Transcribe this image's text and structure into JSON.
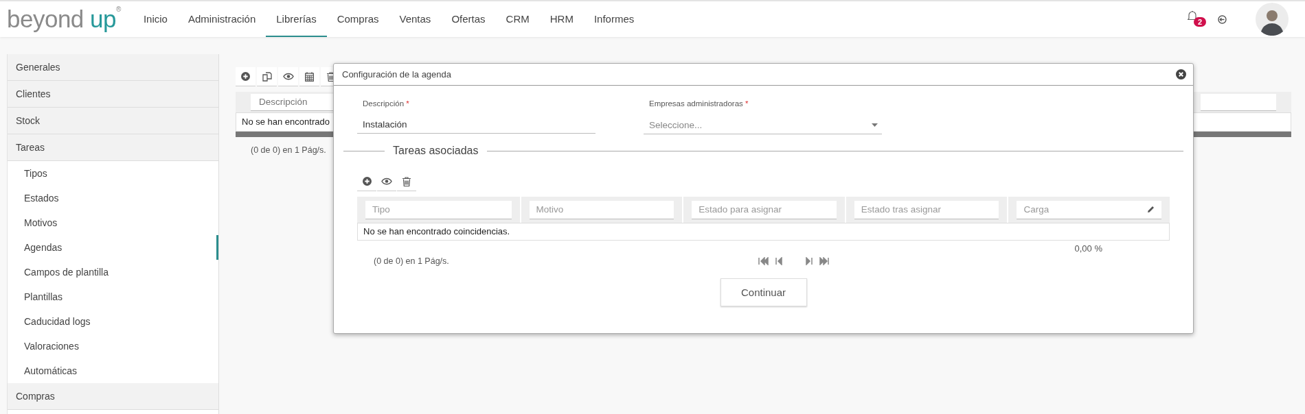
{
  "header": {
    "logo": {
      "main": "beyond",
      "accent": "up",
      "mark": "®"
    },
    "nav": [
      {
        "label": "Inicio",
        "selected": false
      },
      {
        "label": "Administración",
        "selected": false
      },
      {
        "label": "Librerías",
        "selected": true
      },
      {
        "label": "Compras",
        "selected": false
      },
      {
        "label": "Ventas",
        "selected": false
      },
      {
        "label": "Ofertas",
        "selected": false
      },
      {
        "label": "CRM",
        "selected": false
      },
      {
        "label": "HRM",
        "selected": false
      },
      {
        "label": "Informes",
        "selected": false
      }
    ],
    "notifications": {
      "count": "2"
    }
  },
  "sidebar": {
    "items": [
      {
        "label": "Generales"
      },
      {
        "label": "Clientes"
      },
      {
        "label": "Stock"
      },
      {
        "label": "Tareas",
        "children": [
          {
            "label": "Tipos",
            "selected": false
          },
          {
            "label": "Estados",
            "selected": false
          },
          {
            "label": "Motivos",
            "selected": false
          },
          {
            "label": "Agendas",
            "selected": true
          },
          {
            "label": "Campos de plantilla",
            "selected": false
          },
          {
            "label": "Plantillas",
            "selected": false
          },
          {
            "label": "Caducidad logs",
            "selected": false
          },
          {
            "label": "Valoraciones",
            "selected": false
          },
          {
            "label": "Automáticas",
            "selected": false
          }
        ]
      },
      {
        "label": "Compras"
      }
    ]
  },
  "main": {
    "toolbar": [
      {
        "kind": "add"
      },
      {
        "kind": "copy"
      },
      {
        "kind": "view"
      },
      {
        "kind": "calendar"
      },
      {
        "kind": "delete"
      }
    ],
    "table": {
      "filters": [
        {
          "placeholder": "Descripción"
        }
      ],
      "empty_message": "No se han encontrado"
    },
    "pager": "(0 de 0) en 1 Pág/s."
  },
  "dialog": {
    "title": "Configuración de la agenda",
    "fields": [
      {
        "kind": "text",
        "label": "Descripción",
        "required_mark": "*",
        "value": "Instalación"
      },
      {
        "kind": "select",
        "label": "Empresas administradoras",
        "required_mark": "*",
        "placeholder": "Seleccione..."
      }
    ],
    "section": "Tareas asociadas",
    "toolbar": [
      {
        "kind": "add"
      },
      {
        "kind": "view"
      },
      {
        "kind": "delete"
      }
    ],
    "table": {
      "filters": [
        {
          "placeholder": "Tipo",
          "editable": false
        },
        {
          "placeholder": "Motivo",
          "editable": false
        },
        {
          "placeholder": "Estado para asignar",
          "editable": false
        },
        {
          "placeholder": "Estado tras asignar",
          "editable": false
        },
        {
          "placeholder": "Carga",
          "editable": true
        }
      ],
      "empty_message": "No se han encontrado coincidencias.",
      "total": "0,00 %"
    },
    "pager": "(0 de 0) en 1 Pág/s.",
    "button": "Continuar"
  }
}
